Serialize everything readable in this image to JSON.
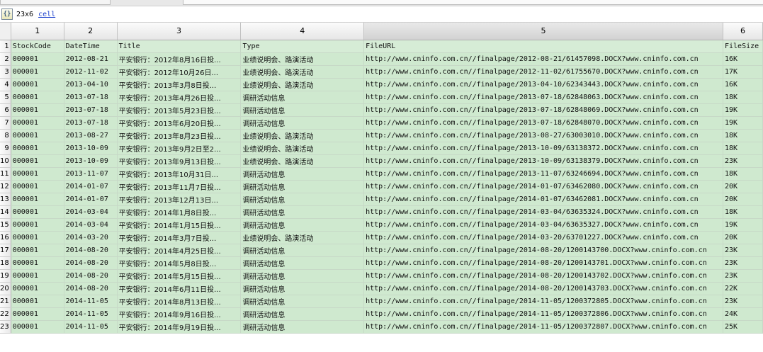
{
  "info": {
    "dims": "23x6",
    "class_link": "cell",
    "icon": "{}"
  },
  "grid": {
    "col_numbers": [
      "1",
      "2",
      "3",
      "4",
      "5",
      "6"
    ],
    "header_row": {
      "row": "1",
      "cells": [
        "StockCode",
        "DateTime",
        "Title",
        "Type",
        "FileURL",
        "FileSize"
      ]
    },
    "rows": [
      {
        "row": "2",
        "cells": [
          "000001",
          "2012-08-21",
          "平安银行：2012年8月16日投...",
          "业绩说明会、路演活动",
          "http://www.cninfo.com.cn//finalpage/2012-08-21/61457098.DOCX?www.cninfo.com.cn",
          "16K"
        ]
      },
      {
        "row": "3",
        "cells": [
          "000001",
          "2012-11-02",
          "平安银行：2012年10月26日...",
          "业绩说明会、路演活动",
          "http://www.cninfo.com.cn//finalpage/2012-11-02/61755670.DOCX?www.cninfo.com.cn",
          "17K"
        ]
      },
      {
        "row": "4",
        "cells": [
          "000001",
          "2013-04-10",
          "平安银行：2013年3月8日投...",
          "业绩说明会、路演活动",
          "http://www.cninfo.com.cn//finalpage/2013-04-10/62343443.DOCX?www.cninfo.com.cn",
          "16K"
        ]
      },
      {
        "row": "5",
        "cells": [
          "000001",
          "2013-07-18",
          "平安银行：2013年4月26日投...",
          "调研活动信息",
          "http://www.cninfo.com.cn//finalpage/2013-07-18/62848063.DOCX?www.cninfo.com.cn",
          "18K"
        ]
      },
      {
        "row": "6",
        "cells": [
          "000001",
          "2013-07-18",
          "平安银行：2013年5月23日投...",
          "调研活动信息",
          "http://www.cninfo.com.cn//finalpage/2013-07-18/62848069.DOCX?www.cninfo.com.cn",
          "19K"
        ]
      },
      {
        "row": "7",
        "cells": [
          "000001",
          "2013-07-18",
          "平安银行：2013年6月20日投...",
          "调研活动信息",
          "http://www.cninfo.com.cn//finalpage/2013-07-18/62848070.DOCX?www.cninfo.com.cn",
          "19K"
        ]
      },
      {
        "row": "8",
        "cells": [
          "000001",
          "2013-08-27",
          "平安银行：2013年8月23日投...",
          "业绩说明会、路演活动",
          "http://www.cninfo.com.cn//finalpage/2013-08-27/63003010.DOCX?www.cninfo.com.cn",
          "18K"
        ]
      },
      {
        "row": "9",
        "cells": [
          "000001",
          "2013-10-09",
          "平安银行：2013年9月2日至2...",
          "业绩说明会、路演活动",
          "http://www.cninfo.com.cn//finalpage/2013-10-09/63138372.DOCX?www.cninfo.com.cn",
          "18K"
        ]
      },
      {
        "row": "10",
        "cells": [
          "000001",
          "2013-10-09",
          "平安银行：2013年9月13日投...",
          "业绩说明会、路演活动",
          "http://www.cninfo.com.cn//finalpage/2013-10-09/63138379.DOCX?www.cninfo.com.cn",
          "23K"
        ]
      },
      {
        "row": "11",
        "cells": [
          "000001",
          "2013-11-07",
          "平安银行：2013年10月31日...",
          "调研活动信息",
          "http://www.cninfo.com.cn//finalpage/2013-11-07/63246694.DOCX?www.cninfo.com.cn",
          "18K"
        ]
      },
      {
        "row": "12",
        "cells": [
          "000001",
          "2014-01-07",
          "平安银行：2013年11月7日投...",
          "调研活动信息",
          "http://www.cninfo.com.cn//finalpage/2014-01-07/63462080.DOCX?www.cninfo.com.cn",
          "20K"
        ]
      },
      {
        "row": "13",
        "cells": [
          "000001",
          "2014-01-07",
          "平安银行：2013年12月13日...",
          "调研活动信息",
          "http://www.cninfo.com.cn//finalpage/2014-01-07/63462081.DOCX?www.cninfo.com.cn",
          "20K"
        ]
      },
      {
        "row": "14",
        "cells": [
          "000001",
          "2014-03-04",
          "平安银行：2014年1月8日投...",
          "调研活动信息",
          "http://www.cninfo.com.cn//finalpage/2014-03-04/63635324.DOCX?www.cninfo.com.cn",
          "18K"
        ]
      },
      {
        "row": "15",
        "cells": [
          "000001",
          "2014-03-04",
          "平安银行：2014年1月15日投...",
          "调研活动信息",
          "http://www.cninfo.com.cn//finalpage/2014-03-04/63635327.DOCX?www.cninfo.com.cn",
          "19K"
        ]
      },
      {
        "row": "16",
        "cells": [
          "000001",
          "2014-03-20",
          "平安银行：2014年3月7日投...",
          "业绩说明会、路演活动",
          "http://www.cninfo.com.cn//finalpage/2014-03-20/63701227.DOCX?www.cninfo.com.cn",
          "20K"
        ]
      },
      {
        "row": "17",
        "cells": [
          "000001",
          "2014-08-20",
          "平安银行：2014年4月25日投...",
          "调研活动信息",
          "http://www.cninfo.com.cn//finalpage/2014-08-20/1200143700.DOCX?www.cninfo.com.cn",
          "23K"
        ]
      },
      {
        "row": "18",
        "cells": [
          "000001",
          "2014-08-20",
          "平安银行：2014年5月8日投...",
          "调研活动信息",
          "http://www.cninfo.com.cn//finalpage/2014-08-20/1200143701.DOCX?www.cninfo.com.cn",
          "23K"
        ]
      },
      {
        "row": "19",
        "cells": [
          "000001",
          "2014-08-20",
          "平安银行：2014年5月15日投...",
          "调研活动信息",
          "http://www.cninfo.com.cn//finalpage/2014-08-20/1200143702.DOCX?www.cninfo.com.cn",
          "23K"
        ]
      },
      {
        "row": "20",
        "cells": [
          "000001",
          "2014-08-20",
          "平安银行：2014年6月11日投...",
          "调研活动信息",
          "http://www.cninfo.com.cn//finalpage/2014-08-20/1200143703.DOCX?www.cninfo.com.cn",
          "22K"
        ]
      },
      {
        "row": "21",
        "cells": [
          "000001",
          "2014-11-05",
          "平安银行：2014年8月13日投...",
          "调研活动信息",
          "http://www.cninfo.com.cn//finalpage/2014-11-05/1200372805.DOCX?www.cninfo.com.cn",
          "23K"
        ]
      },
      {
        "row": "22",
        "cells": [
          "000001",
          "2014-11-05",
          "平安银行：2014年9月16日投...",
          "调研活动信息",
          "http://www.cninfo.com.cn//finalpage/2014-11-05/1200372806.DOCX?www.cninfo.com.cn",
          "24K"
        ]
      },
      {
        "row": "23",
        "cells": [
          "000001",
          "2014-11-05",
          "平安银行：2014年9月19日投...",
          "调研活动信息",
          "http://www.cninfo.com.cn//finalpage/2014-11-05/1200372807.DOCX?www.cninfo.com.cn",
          "25K"
        ]
      }
    ]
  }
}
